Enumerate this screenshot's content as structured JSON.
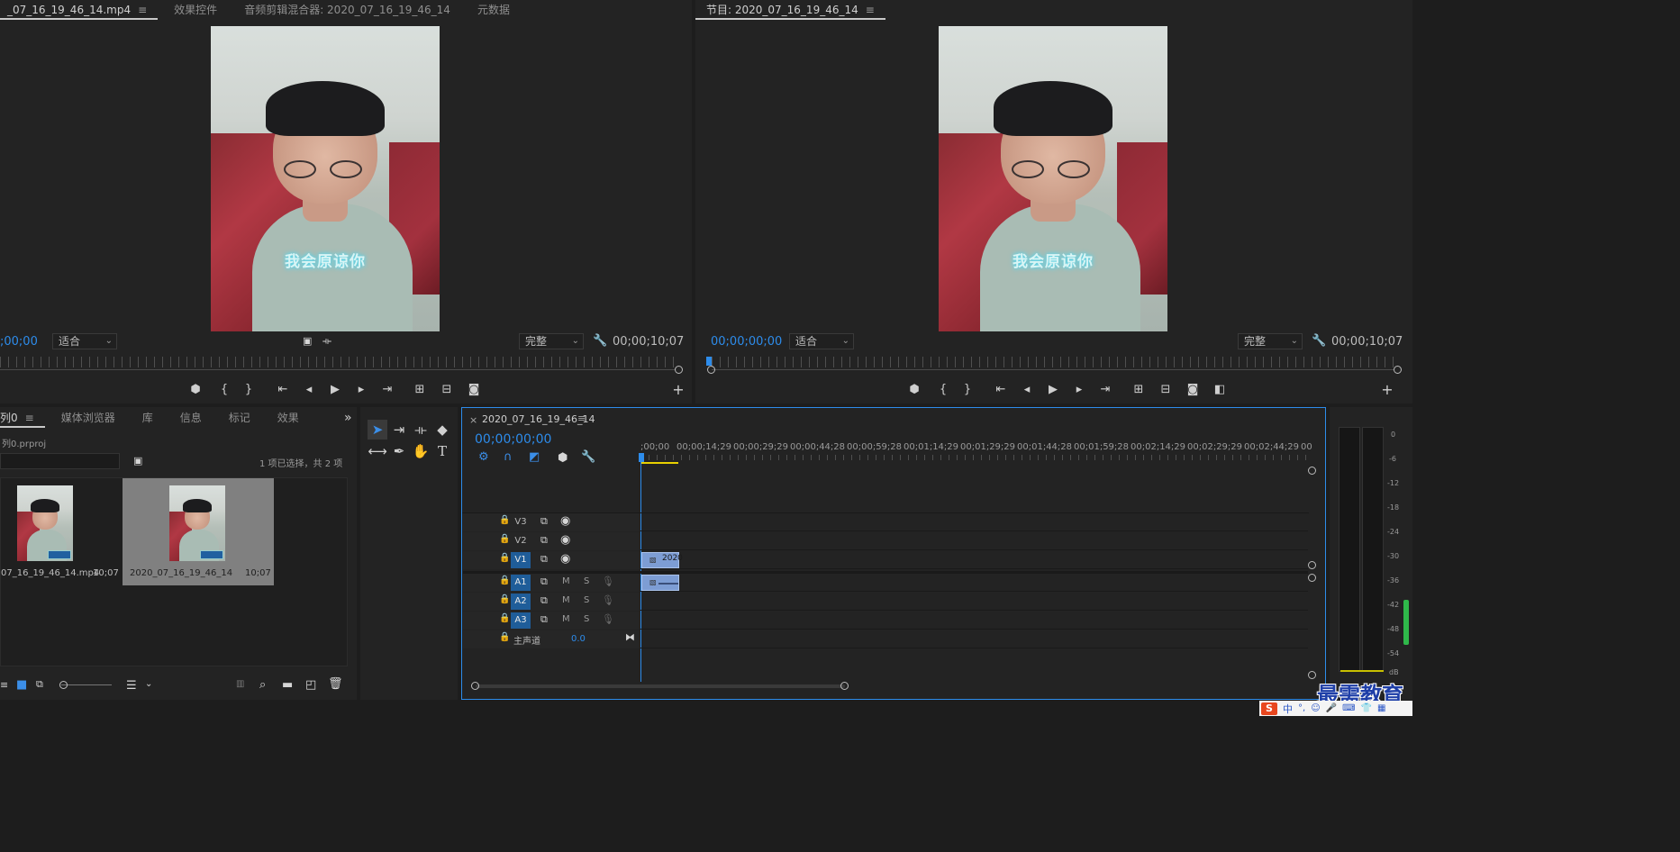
{
  "source_monitor": {
    "tabs": [
      {
        "label": "_07_16_19_46_14.mp4",
        "active": true
      },
      {
        "label": "效果控件",
        "active": false
      },
      {
        "label": "音频剪辑混合器: 2020_07_16_19_46_14",
        "active": false
      },
      {
        "label": "元数据",
        "active": false
      }
    ],
    "timecode": ";00;00",
    "fit_select": "适合",
    "quality_select": "完整",
    "duration": "00;00;10;07",
    "caption": "我会原谅你"
  },
  "program_monitor": {
    "title": "节目: 2020_07_16_19_46_14",
    "timecode": "00;00;00;00",
    "fit_select": "适合",
    "quality_select": "完整",
    "duration": "00;00;10;07",
    "caption": "我会原谅你"
  },
  "project_panel": {
    "tabs": [
      {
        "label": "列0",
        "active": true
      },
      {
        "label": "媒体浏览器",
        "active": false
      },
      {
        "label": "库",
        "active": false
      },
      {
        "label": "信息",
        "active": false
      },
      {
        "label": "标记",
        "active": false
      },
      {
        "label": "效果",
        "active": false
      }
    ],
    "more": "»",
    "project_file": "列0.prproj",
    "selection_status": "1 项已选择，共 2 项",
    "items": [
      {
        "name": "07_16_19_46_14.mp4",
        "duration": "10;07"
      },
      {
        "name": "2020_07_16_19_46_14",
        "duration": "10;07"
      }
    ]
  },
  "timeline": {
    "close": "×",
    "sequence_name": "2020_07_16_19_46_14",
    "timecode": "00;00;00;00",
    "ruler_labels": [
      ";00;00",
      "00;00;14;29",
      "00;00;29;29",
      "00;00;44;28",
      "00;00;59;28",
      "00;01;14;29",
      "00;01;29;29",
      "00;01;44;28",
      "00;01;59;28",
      "00;02;14;29",
      "00;02;29;29",
      "00;02;44;29",
      "00"
    ],
    "video_tracks": [
      "V3",
      "V2",
      "V1"
    ],
    "audio_tracks": [
      "A1",
      "A2",
      "A3"
    ],
    "mute_label": "M",
    "solo_label": "S",
    "master": {
      "label": "主声道",
      "value": "0.0"
    },
    "clip_label": "2020"
  },
  "audio_meter": {
    "scale": [
      "0",
      "-6",
      "-12",
      "-18",
      "-24",
      "-30",
      "-36",
      "-42",
      "-48",
      "-54",
      "dB"
    ]
  },
  "watermark": "最需教育",
  "ime": {
    "items": [
      "中",
      "°,",
      "☺",
      "🎤",
      "⌨",
      "👕",
      "▦"
    ]
  }
}
